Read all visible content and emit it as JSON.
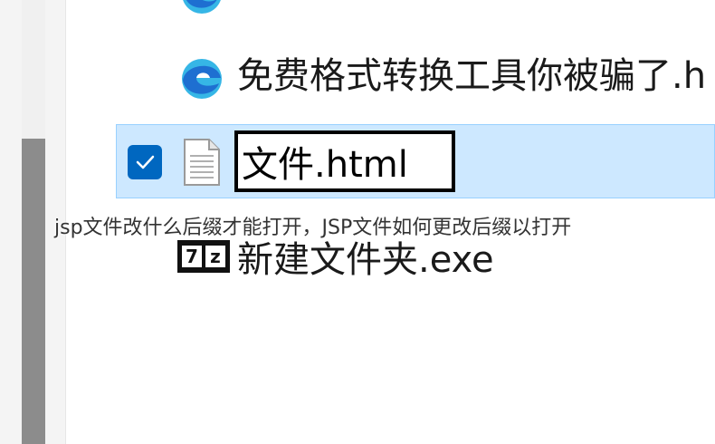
{
  "file_list": {
    "items": [
      {
        "name": "",
        "icon": "edge-browser-icon",
        "partial": true
      },
      {
        "name": "免费格式转换工具你被骗了.h",
        "icon": "edge-browser-icon"
      },
      {
        "name": "",
        "icon": "text-document-icon",
        "selected": true,
        "checked": true,
        "rename_value": "文件.html"
      },
      {
        "name": "新建文件夹.exe",
        "icon": "7z-archive-icon"
      }
    ]
  },
  "overlay": {
    "caption": "jsp文件改什么后缀才能打开，JSP文件如何更改后缀以打开"
  },
  "icon_7z": {
    "left": "7",
    "right": "z"
  },
  "colors": {
    "selection_bg": "#cde8ff",
    "selection_border": "#99d1ff",
    "checkbox_blue": "#0067c0",
    "edge_blue_dark": "#1e6fd1",
    "edge_blue_light": "#36b6e6",
    "scrollbar_thumb": "#8c8c8c"
  }
}
